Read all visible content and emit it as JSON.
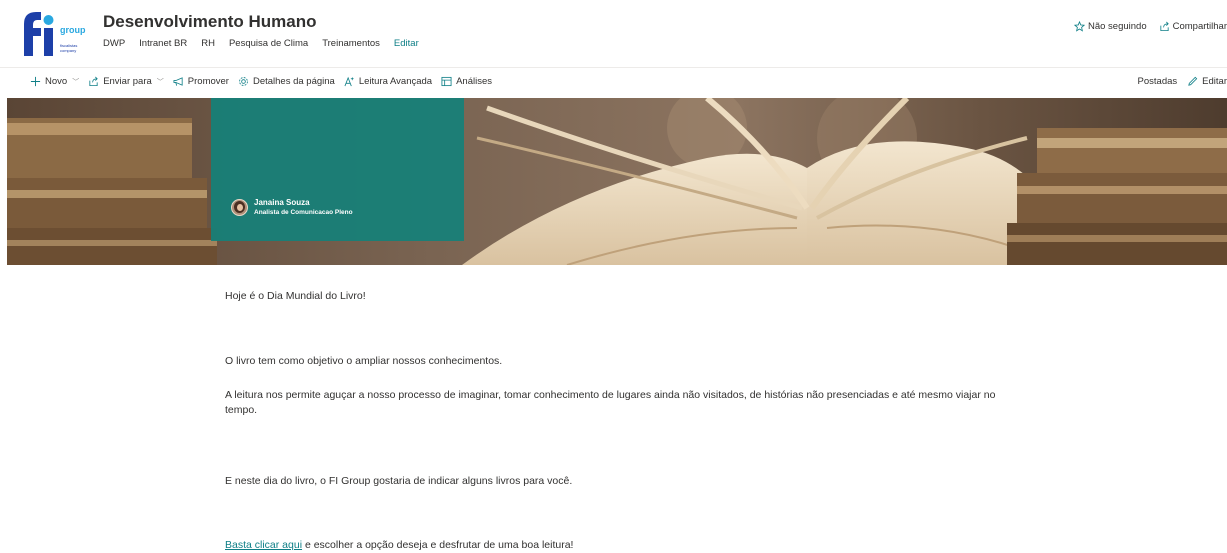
{
  "site": {
    "logo_text": "fi",
    "logo_sub": "group",
    "logo_tagline": "fiscalistas company",
    "title": "Desenvolvimento Humano",
    "nav": [
      "DWP",
      "Intranet BR",
      "RH",
      "Pesquisa de Clima",
      "Treinamentos"
    ],
    "nav_edit": "Editar",
    "follow": "Não seguindo",
    "share": "Compartilhar"
  },
  "commandbar": {
    "new": "Novo",
    "send_to": "Enviar para",
    "promote": "Promover",
    "page_details": "Detalhes da página",
    "immersive_reader": "Leitura Avançada",
    "analytics": "Análises",
    "published": "Postadas",
    "edit": "Editar"
  },
  "banner": {
    "author_name": "Janaina Souza",
    "author_role": "Analista de Comunicacao Pleno"
  },
  "article": {
    "p1": "Hoje é o Dia Mundial do Livro!",
    "p2": "O livro tem como objetivo o ampliar nossos conhecimentos.",
    "p3": "A leitura nos permite aguçar a nosso processo de imaginar, tomar conhecimento de lugares ainda não visitados, de histórias não presenciadas e até mesmo viajar no tempo.",
    "p4": "E neste dia do livro, o FI Group gostaria de indicar alguns livros para você.",
    "link_text": "Basta clicar aqui",
    "p5_rest": " e escolher a opção deseja e desfrutar de uma boa leitura!"
  },
  "colors": {
    "accent": "#0f7f87",
    "brand_blue": "#1d3fa8",
    "panel_teal": "#168078"
  }
}
